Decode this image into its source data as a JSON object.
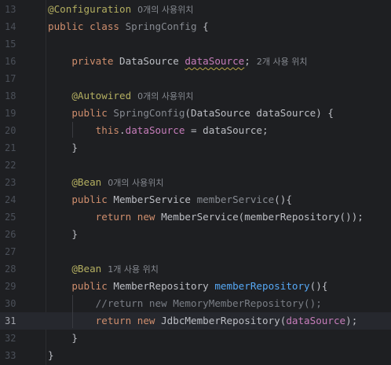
{
  "editor": {
    "current_line": 31,
    "lines": [
      {
        "n": "13",
        "tokens": [
          [
            "@Configuration",
            "ann"
          ],
          [
            "0개의 사용위치",
            "hint"
          ]
        ]
      },
      {
        "n": "14",
        "tokens": [
          [
            "public class ",
            "kw"
          ],
          [
            "SpringConfig",
            "unused"
          ],
          [
            " {",
            ""
          ]
        ]
      },
      {
        "n": "15",
        "tokens": []
      },
      {
        "n": "16",
        "tokens": [
          [
            "    ",
            ""
          ],
          [
            "private ",
            "kw"
          ],
          [
            "DataSource ",
            ""
          ],
          [
            "dataSource",
            "field warn"
          ],
          [
            ";",
            ""
          ],
          [
            "2개 사용 위치",
            "hint"
          ]
        ]
      },
      {
        "n": "17",
        "tokens": []
      },
      {
        "n": "18",
        "tokens": [
          [
            "    ",
            ""
          ],
          [
            "@Autowired",
            "ann"
          ],
          [
            "0개의 사용위치",
            "hint"
          ]
        ]
      },
      {
        "n": "19",
        "tokens": [
          [
            "    ",
            ""
          ],
          [
            "public ",
            "kw"
          ],
          [
            "SpringConfig",
            "unused"
          ],
          [
            "(DataSource dataSource) {",
            ""
          ]
        ]
      },
      {
        "n": "20",
        "tokens": [
          [
            "        ",
            ""
          ],
          [
            "this",
            "kw"
          ],
          [
            ".",
            ""
          ],
          [
            "dataSource",
            "field"
          ],
          [
            " = dataSource;",
            ""
          ]
        ]
      },
      {
        "n": "21",
        "tokens": [
          [
            "    }",
            ""
          ]
        ]
      },
      {
        "n": "22",
        "tokens": []
      },
      {
        "n": "23",
        "tokens": [
          [
            "    ",
            ""
          ],
          [
            "@Bean",
            "ann"
          ],
          [
            "0개의 사용위치",
            "hint"
          ]
        ]
      },
      {
        "n": "24",
        "tokens": [
          [
            "    ",
            ""
          ],
          [
            "public ",
            "kw"
          ],
          [
            "MemberService ",
            ""
          ],
          [
            "memberService",
            "unused"
          ],
          [
            "(){",
            ""
          ]
        ]
      },
      {
        "n": "25",
        "tokens": [
          [
            "        ",
            ""
          ],
          [
            "return new ",
            "kw"
          ],
          [
            "MemberService(memberRepository());",
            ""
          ]
        ]
      },
      {
        "n": "26",
        "tokens": [
          [
            "    }",
            ""
          ]
        ]
      },
      {
        "n": "27",
        "tokens": []
      },
      {
        "n": "28",
        "tokens": [
          [
            "    ",
            ""
          ],
          [
            "@Bean",
            "ann"
          ],
          [
            "1개 사용 위치",
            "hint"
          ]
        ]
      },
      {
        "n": "29",
        "tokens": [
          [
            "    ",
            ""
          ],
          [
            "public ",
            "kw"
          ],
          [
            "MemberRepository ",
            ""
          ],
          [
            "memberRepository",
            "decl"
          ],
          [
            "(){",
            ""
          ]
        ]
      },
      {
        "n": "30",
        "tokens": [
          [
            "        ",
            ""
          ],
          [
            "//return new MemoryMemberRepository();",
            "cmt"
          ]
        ]
      },
      {
        "n": "31",
        "tokens": [
          [
            "        ",
            ""
          ],
          [
            "return new ",
            "kw"
          ],
          [
            "JdbcMemberRepository(",
            ""
          ],
          [
            "dataSource",
            "field"
          ],
          [
            ");",
            ""
          ]
        ]
      },
      {
        "n": "32",
        "tokens": [
          [
            "    }",
            ""
          ]
        ]
      },
      {
        "n": "33",
        "tokens": [
          [
            "}",
            ""
          ]
        ]
      }
    ]
  }
}
